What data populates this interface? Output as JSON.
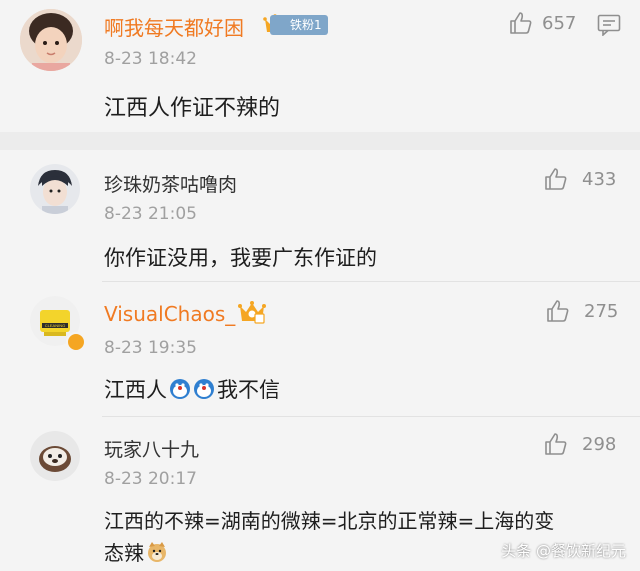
{
  "comments": [
    {
      "username": "啊我每天都好困",
      "badge": "铁粉1",
      "time": "8-23 18:42",
      "text": "江西人作证不辣的",
      "likes": "657"
    },
    {
      "username": "珍珠奶茶咕噜肉",
      "time": "8-23 21:05",
      "text": "你作证没用，我要广东作证的",
      "likes": "433"
    },
    {
      "username": "VisualChaos_",
      "time": "8-23 19:35",
      "text_before": "江西人",
      "text_after": "我不信",
      "likes": "275"
    },
    {
      "username": "玩家八十九",
      "time": "8-23 20:17",
      "text_line1": "江西的不辣=湖南的微辣=北京的正常辣=上海的变",
      "text_line2": "态辣",
      "likes": "298"
    }
  ],
  "colors": {
    "vip_name": "#f07a22",
    "normal_name": "#333333",
    "badge_bg": "#f5a623",
    "time": "#a0a0a0",
    "background": "#f4f4f4"
  },
  "watermark": "头条 @餐饮新纪元"
}
